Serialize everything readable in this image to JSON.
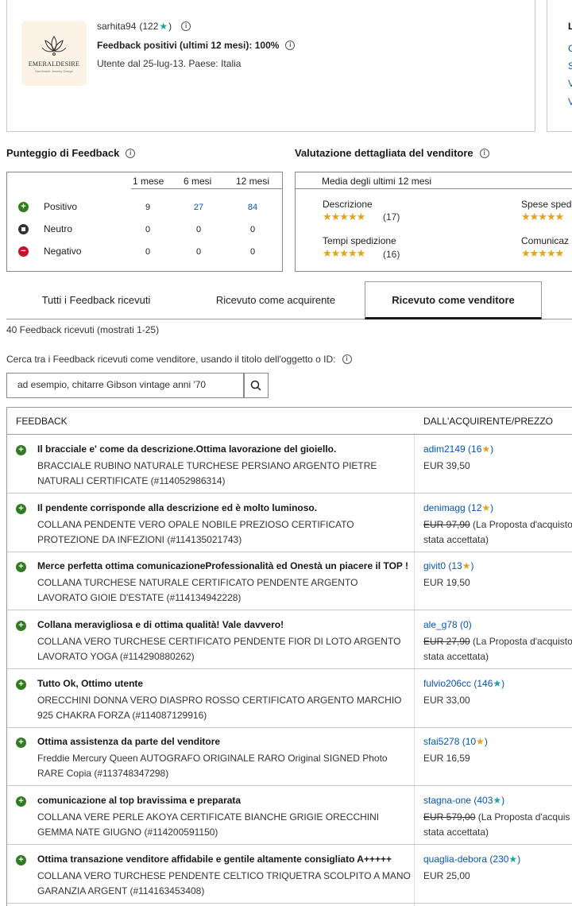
{
  "seller": {
    "name": "sarhita94",
    "score": "(122",
    "score_end": ")",
    "positive_label": "Feedback positivi (ultimi 12 mesi): 100%",
    "since": "Utente dal 25-lug-13. Paese: Italia",
    "logo_text": "EMERALDESIRE",
    "logo_sub": "Handmade Jewelry Design"
  },
  "right_card": {
    "head": "L",
    "links": [
      "C",
      "S",
      "V",
      "V"
    ]
  },
  "feedback_score": {
    "title": "Punteggio di Feedback",
    "columns": [
      "1 mese",
      "6 mesi",
      "12 mesi"
    ],
    "rows": [
      {
        "label": "Positivo",
        "values": [
          "9",
          "27",
          "84"
        ]
      },
      {
        "label": "Neutro",
        "values": [
          "0",
          "0",
          "0"
        ]
      },
      {
        "label": "Negativo",
        "values": [
          "0",
          "0",
          "0"
        ]
      }
    ]
  },
  "detailed_ratings": {
    "title": "Valutazione dettagliata del venditore",
    "header": "Media degli ultimi 12 mesi",
    "items": [
      {
        "label": "Descrizione",
        "count": "(17)"
      },
      {
        "label": "Tempi spedizione",
        "count": "(16)"
      },
      {
        "label": "Spese sped"
      },
      {
        "label": "Comunicaz"
      }
    ]
  },
  "tabs": [
    "Tutti i Feedback ricevuti",
    "Ricevuto come acquirente",
    "Ricevuto come venditore"
  ],
  "count_text": "40 Feedback ricevuti (mostrati 1-25)",
  "search": {
    "label": "Cerca tra i Feedback ricevuti come venditore, usando il titolo dell'oggetto o ID:",
    "placeholder": "ad esempio, chitarre Gibson vintage anni '70"
  },
  "list_headers": {
    "feedback": "FEEDBACK",
    "buyer": "DALL'ACQUIRENTE/PREZZO"
  },
  "feedback_rows": [
    {
      "comment": "Il bracciale e' come da descrizione.Ottima lavorazione del gioiello.",
      "item": "BRACCIALE RUBINO NATURALE TURCHESE PERSIANO ARGENTO PIETRE NATURALI CERTIFICATE (#114052986314)",
      "buyer": "adim2149 (16",
      "star": "★",
      "star_color": "gold",
      "price_old": "",
      "price": "EUR 39,50",
      "price_extra": ""
    },
    {
      "comment": "Il pendente corrisponde alla descrizione ed è molto luminoso.",
      "item": "COLLANA PENDENTE VERO OPALE NOBILE PREZIOSO CERTIFICATO PROTEZIONE DA INFEZIONI (#114135021743)",
      "buyer": "denimagg (12",
      "star": "★",
      "star_color": "gold",
      "price_old": "EUR 97,90",
      "price": "(La Proposta d'acquisto",
      "price_extra": "stata accettata)"
    },
    {
      "comment": "Merce perfetta ottima comunicazioneProfessionalità ed Onestà un piacere il TOP !",
      "item": "COLLANA TURCHESE NATURALE CERTIFICATO PENDENTE ARGENTO LAVORATO GIOIE D'ESTATE (#114134942228)",
      "buyer": "givit0 (13",
      "star": "★",
      "star_color": "gold",
      "price_old": "",
      "price": "EUR 19,50",
      "price_extra": ""
    },
    {
      "comment": "Collana meravigliosa e di ottima qualità! Vale davvero!",
      "item": "COLLANA VERO TURCHESE CERTIFICATO PENDENTE FIOR DI LOTO ARGENTO LAVORATO YOGA (#114290880262)",
      "buyer": "ale_g78 (0)",
      "star": "",
      "star_color": "",
      "price_old": "EUR 27,90",
      "price": "(La Proposta d'acquisto",
      "price_extra": "stata accettata)"
    },
    {
      "comment": "Tutto Ok, Ottimo utente",
      "item": "ORECCHINI DONNA VERO DIASPRO ROSSO CERTIFICATO ARGENTO MARCHIO 925 CHAKRA FORZA (#114087129916)",
      "buyer": "fulvio206cc (146",
      "star": "★",
      "star_color": "teal",
      "price_old": "",
      "price": "EUR 33,00",
      "price_extra": ""
    },
    {
      "comment": "Ottima assistenza da parte del venditore",
      "item": "Freddie Mercury Queen AUTOGRAFO ORIGINALE RARO Original SIGNED Photo RARE Copia (#113748347298)",
      "buyer": "sfai5278 (10",
      "star": "★",
      "star_color": "gold",
      "price_old": "",
      "price": "EUR 16,59",
      "price_extra": ""
    },
    {
      "comment": "comunicazione al top bravissima e preparata",
      "item": "COLLANA VERE PERLE AKOYA CERTIFICATE BIANCHE GRIGIE ORECCHINI GEMMA NATE GIUGNO (#114200591150)",
      "buyer": "stagna-one (403",
      "star": "★",
      "star_color": "teal",
      "price_old": "EUR 579,00",
      "price": "(La Proposta d'acquis",
      "price_extra": "stata accettata)"
    },
    {
      "comment": "Ottima transazione venditore affidabile e gentile altamente consigliato A+++++",
      "item": "COLLANA VERO TURCHESE PENDENTE CELTICO TRIQUETRA SCOLPITO A MANO GARANZIA ARGENT (#114163453408)",
      "buyer": "quaglia-debora (230",
      "star": "★",
      "star_color": "teal",
      "price_old": "",
      "price": "EUR 25,00",
      "price_extra": ""
    }
  ]
}
